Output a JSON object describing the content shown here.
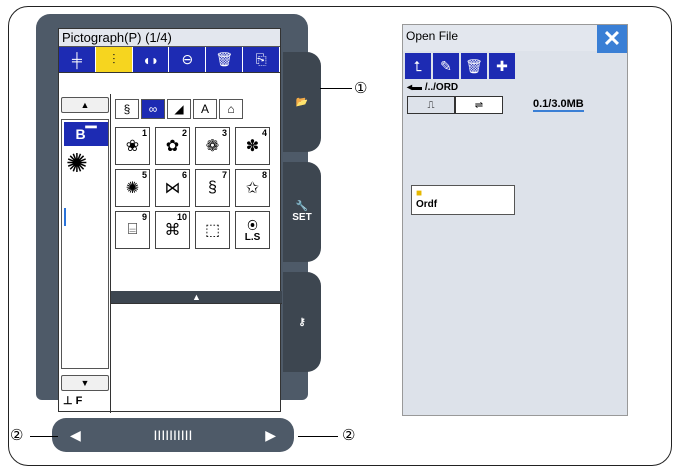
{
  "left_screen": {
    "title": "Pictograph(P) (1/4)",
    "toolbar_items": [
      "stitch-pattern",
      "selected-mirror",
      "mirror-vertical",
      "elongate",
      "delete",
      "export"
    ],
    "stitch_numbers": [
      "1",
      "2",
      "3",
      "4",
      "5",
      "6",
      "7",
      "8",
      "9",
      "10",
      "",
      "L.S"
    ],
    "category_labels": [
      "",
      "",
      "",
      "A",
      ""
    ],
    "mode_label": "B",
    "foot_label": "F"
  },
  "side_tabs": {
    "set_label": "SET"
  },
  "bottom_bar": {
    "dots": "IIIIIIIIII"
  },
  "callouts": {
    "c1": "①",
    "c2": "②",
    "c3": "②"
  },
  "file_screen": {
    "title": "Open File",
    "path": "/../ORD",
    "storage": "0.1/3.0MB",
    "folder_name": "Ordf"
  }
}
